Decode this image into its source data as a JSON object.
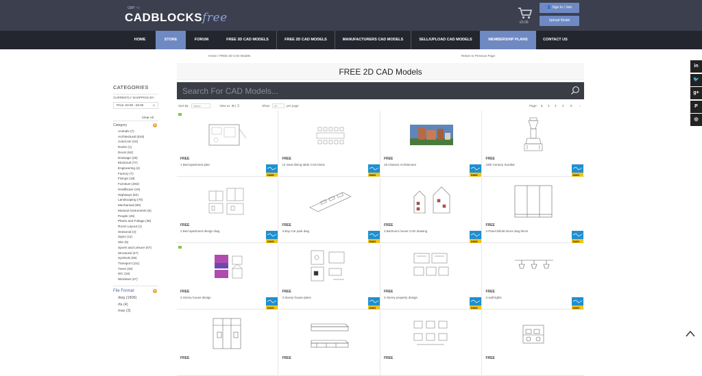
{
  "header": {
    "currency": "GBP ~ |",
    "logo_main": "CADBLOCKS",
    "logo_free": "free",
    "cart_total": "£0.00",
    "signin_label": "Sign In / Join",
    "upload_label": "Upload Model"
  },
  "nav": {
    "items": [
      {
        "label": "HOME"
      },
      {
        "label": "STORE"
      },
      {
        "label": "FORUM"
      },
      {
        "label": "FREE 3D CAD MODELS"
      },
      {
        "label": "FREE 2D CAD MODELS"
      },
      {
        "label": "MANUFACTURERS CAD MODELS"
      },
      {
        "label": "SELL/UPLOAD CAD MODELS"
      },
      {
        "label": "MEMBERSHIP PLANS"
      },
      {
        "label": "CONTACT US"
      }
    ]
  },
  "breadcrumb": "Home / FREE 2D CAD Models",
  "return_link": "Return to Previous Page",
  "page_title": "FREE 2D CAD Models",
  "search": {
    "placeholder": "Search For CAD Models..."
  },
  "toolbar": {
    "sort_label": "Sort By",
    "sort_value": "Name",
    "view_label": "View as",
    "view_value": "⊞ | ☰",
    "show_label": "Show",
    "show_value": "20",
    "per_page": "per page",
    "page_label": "Page:",
    "pages": [
      "1",
      "2",
      "3",
      "4",
      "5",
      "›"
    ]
  },
  "sidebar": {
    "title": "CATEGORIES",
    "currently": "CURRENTLY SHOPPING BY:",
    "price_filter": "Price: £0.00 - £0.00",
    "clear_all": "Clear All",
    "category_head": "Category",
    "categories": [
      "Animals (7)",
      "Architectural (518)",
      "AutoCAD (19)",
      "Docks (1)",
      "Doors (62)",
      "Drainage (28)",
      "Electrical (77)",
      "Engineering (4)",
      "Factory (7)",
      "Fixings (18)",
      "Furniture (292)",
      "Healthcare (19)",
      "Highways (52)",
      "Landscaping (70)",
      "Mechanical (90)",
      "Musical Instruments (5)",
      "People (29)",
      "Plants and Foliage (36)",
      "Room Layout (1)",
      "Seasonal (4)",
      "Signs (11)",
      "Site (9)",
      "Sports and Leisure (67)",
      "Structural (27)",
      "Symbols (56)",
      "Transport (111)",
      "Trees (29)",
      "WC (18)",
      "Windows (47)"
    ],
    "format_head": "File Format",
    "formats": [
      "dwg (1806)",
      "rfa (4)",
      "max (3)"
    ]
  },
  "products": [
    {
      "free": "FREE",
      "name": "1 Bed apartment plan",
      "badge": "DWG"
    },
    {
      "free": "FREE",
      "name": "14 Seat dining table CAD block",
      "badge": "DWG"
    },
    {
      "free": "FREE",
      "name": "16 Classes Architecture",
      "badge": "DWG"
    },
    {
      "free": "FREE",
      "name": "18th Century Sundial",
      "badge": "DWG"
    },
    {
      "free": "FREE",
      "name": "2 Bed apartment design dwg",
      "badge": "DWG"
    },
    {
      "free": "FREE",
      "name": "3 Bay Car park dwg",
      "badge": "DWG"
    },
    {
      "free": "FREE",
      "name": "3 Bedroom house CAD drawing",
      "badge": "DWG"
    },
    {
      "free": "FREE",
      "name": "3 Panel Bifold doors dwg block",
      "badge": "DWG"
    },
    {
      "free": "FREE",
      "name": "3 Storey house design",
      "badge": "DWG"
    },
    {
      "free": "FREE",
      "name": "3 Storey house plans",
      "badge": "DWG"
    },
    {
      "free": "FREE",
      "name": "3 Storey property design",
      "badge": "DWG"
    },
    {
      "free": "FREE",
      "name": "3 wall lights",
      "badge": "DWG"
    },
    {
      "free": "FREE",
      "name": "",
      "badge": ""
    },
    {
      "free": "FREE",
      "name": "",
      "badge": ""
    },
    {
      "free": "FREE",
      "name": "",
      "badge": ""
    },
    {
      "free": "FREE",
      "name": "",
      "badge": ""
    }
  ],
  "social": [
    {
      "glyph": "in",
      "icon": "linkedin-icon"
    },
    {
      "glyph": "🐦",
      "icon": "twitter-icon"
    },
    {
      "glyph": "g+",
      "icon": "google-plus-icon"
    },
    {
      "glyph": "P",
      "icon": "pinterest-icon"
    },
    {
      "glyph": "◎",
      "icon": "instagram-icon"
    }
  ],
  "colors": {
    "header_bg": "#3b3f4e",
    "nav_bg": "#23262f",
    "accent": "#6f89c3",
    "search_bg": "#3a3d45",
    "dwg_blue": "#1f8fd0",
    "dwg_yellow": "#f2c318"
  }
}
